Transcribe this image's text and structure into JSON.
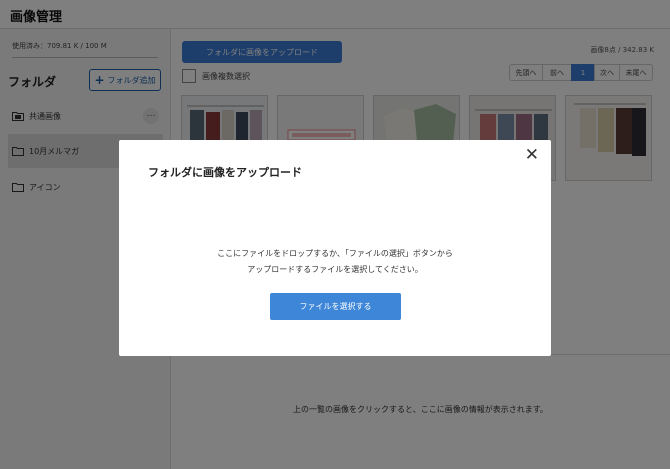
{
  "header": {
    "title": "画像管理"
  },
  "sidebar": {
    "usage": "使用済み：709.81 K / 100 M",
    "folders_heading": "フォルダ",
    "add_folder_label": "フォルダ追加",
    "items": [
      {
        "label": "共通画像",
        "icon": "shared-folder-icon",
        "selected": false,
        "has_menu": true
      },
      {
        "label": "10月メルマガ",
        "icon": "folder-icon",
        "selected": true,
        "has_menu": false
      },
      {
        "label": "アイコン",
        "icon": "folder-icon",
        "selected": false,
        "has_menu": false
      }
    ],
    "more_symbol": "…"
  },
  "main": {
    "upload_label": "フォルダに画像をアップロード",
    "image_count": "画像8点 / 342.83 K",
    "multi_select_label": "画像複数選択",
    "pagination": {
      "first": "先頭へ",
      "prev": "前へ",
      "current": "1",
      "next": "次へ",
      "last": "末尾へ"
    },
    "info_placeholder": "上の一覧の画像をクリックすると、ここに画像の情報が表示されます。"
  },
  "modal": {
    "title": "フォルダに画像をアップロード",
    "close_symbol": "✕",
    "message_line1": "ここにファイルをドロップするか、「ファイルの選択」ボタンから",
    "message_line2": "アップロードするファイルを選択してください。",
    "select_button_label": "ファイルを選択する"
  },
  "colors": {
    "accent": "#3a7bd5",
    "overlay": "#000000"
  }
}
